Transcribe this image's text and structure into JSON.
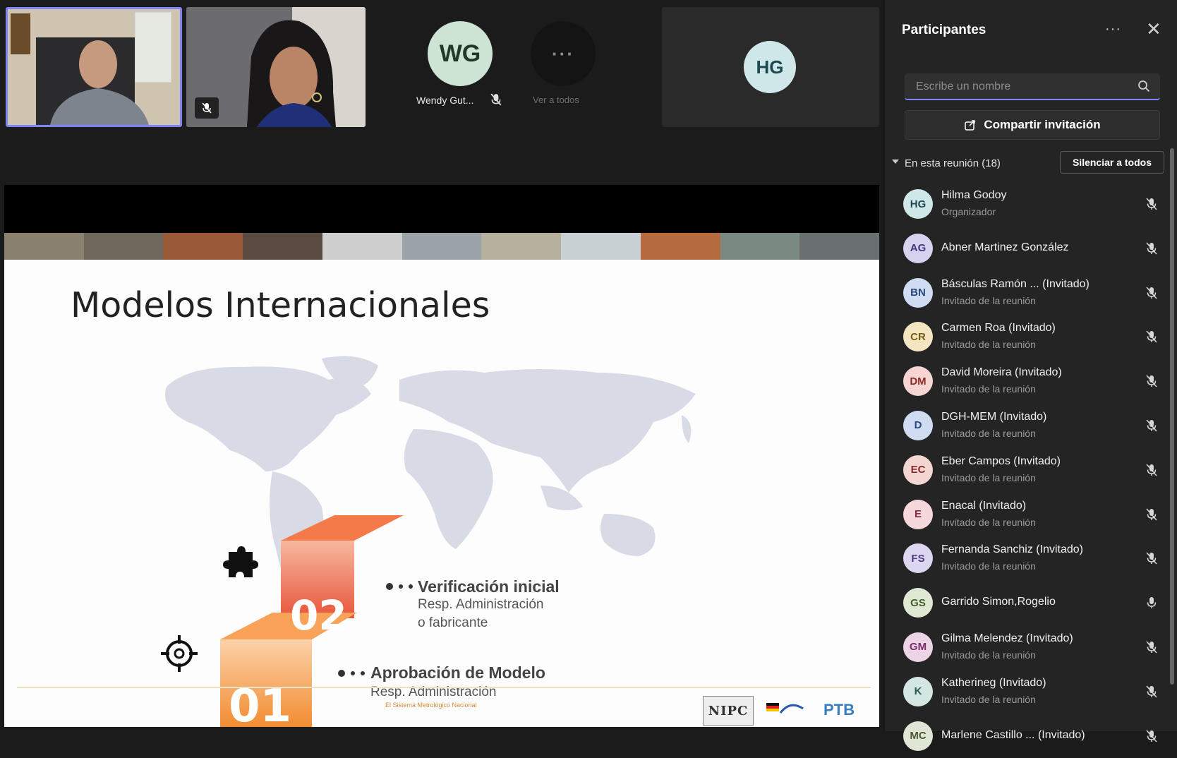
{
  "stage": {
    "tiles": [
      {
        "name": "Wendy Gut...",
        "initials": "WG"
      },
      {
        "name": "Ver a todos",
        "initials": "···"
      },
      {
        "initials": "HG"
      }
    ],
    "slide": {
      "title": "Modelos Internacionales",
      "step_02": {
        "number": "02",
        "title": "Verificación inicial",
        "line1": "Resp. Administración",
        "line2": "o fabricante"
      },
      "step_01": {
        "number": "01",
        "title": "Aprobación de Modelo",
        "line1": "Resp. Administración",
        "caption": "El Sistema Metrológico Nacional"
      },
      "logo_left": "NIPC",
      "logo_right": "PTB"
    }
  },
  "sidebar": {
    "title": "Participantes",
    "more": "···",
    "close": "✕",
    "search_placeholder": "Escribe un nombre",
    "share_invite": "Compartir invitación",
    "section_label": "En esta reunión (18)",
    "mute_all": "Silenciar a todos",
    "participants": [
      {
        "initials": "HG",
        "name": "Hilma Godoy",
        "role": "Organizador",
        "bg": "#cfe7e8",
        "fg": "#1d4a52",
        "mic": "off"
      },
      {
        "initials": "AG",
        "name": "Abner Martinez González",
        "role": "",
        "bg": "#d7d3ef",
        "fg": "#3d3a7a",
        "mic": "off"
      },
      {
        "initials": "BN",
        "name": "Básculas Ramón ... (Invitado)",
        "role": "Invitado de la reunión",
        "bg": "#cfdcf2",
        "fg": "#27477e",
        "mic": "off"
      },
      {
        "initials": "CR",
        "name": "Carmen Roa (Invitado)",
        "role": "Invitado de la reunión",
        "bg": "#f5e6c2",
        "fg": "#7a5a12",
        "mic": "off"
      },
      {
        "initials": "DM",
        "name": "David Moreira (Invitado)",
        "role": "Invitado de la reunión",
        "bg": "#f6d5d3",
        "fg": "#8a2b27",
        "mic": "off"
      },
      {
        "initials": "D",
        "name": "DGH-MEM (Invitado)",
        "role": "Invitado de la reunión",
        "bg": "#cfdcf2",
        "fg": "#27477e",
        "mic": "off"
      },
      {
        "initials": "EC",
        "name": "Eber Campos (Invitado)",
        "role": "Invitado de la reunión",
        "bg": "#f3d5d1",
        "fg": "#8a2b27",
        "mic": "off"
      },
      {
        "initials": "E",
        "name": "Enacal (Invitado)",
        "role": "Invitado de la reunión",
        "bg": "#f6d7dc",
        "fg": "#8a2b45",
        "mic": "off"
      },
      {
        "initials": "FS",
        "name": "Fernanda Sanchiz (Invitado)",
        "role": "Invitado de la reunión",
        "bg": "#ddd6f0",
        "fg": "#4a3d80",
        "mic": "off"
      },
      {
        "initials": "GS",
        "name": "Garrido Simon,Rogelio",
        "role": "",
        "bg": "#dfe8d3",
        "fg": "#44602a",
        "mic": "on"
      },
      {
        "initials": "GM",
        "name": "Gilma Melendez (Invitado)",
        "role": "Invitado de la reunión",
        "bg": "#ecd3e6",
        "fg": "#7a2d69",
        "mic": "off"
      },
      {
        "initials": "K",
        "name": "Katherineg (Invitado)",
        "role": "Invitado de la reunión",
        "bg": "#d3e6e2",
        "fg": "#285a52",
        "mic": "off"
      },
      {
        "initials": "MC",
        "name": "Marlene Castillo ... (Invitado)",
        "role": "",
        "bg": "#e0e6d6",
        "fg": "#4a5a32",
        "mic": "off"
      }
    ]
  },
  "colors": {
    "accent": "#7f85f5",
    "step_02": "#e8553a",
    "step_01": "#f28c32",
    "map": "#d8dae6"
  }
}
